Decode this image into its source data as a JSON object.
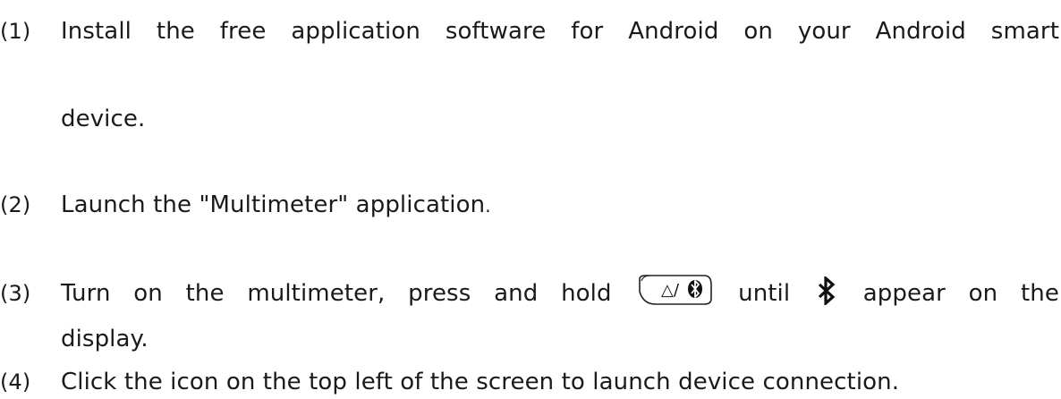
{
  "steps": [
    {
      "number": "(1)",
      "text_line1": "Install the free application software for Android on your Android smart",
      "text_line2": "device."
    },
    {
      "number": "(2)",
      "text_before": "Launch the \"Multimeter\" application",
      "text_end": "."
    },
    {
      "number": "(3)",
      "text_before": "Turn on the multimeter, press and hold",
      "key_label": "△/",
      "key_icon": "bluetooth-icon",
      "text_middle": "until",
      "inline_icon": "bluetooth-icon",
      "text_after": "appear on the",
      "text_line2": "display."
    },
    {
      "number": "(4)",
      "text": "Click the icon on the top left of the screen to launch device connection."
    }
  ]
}
